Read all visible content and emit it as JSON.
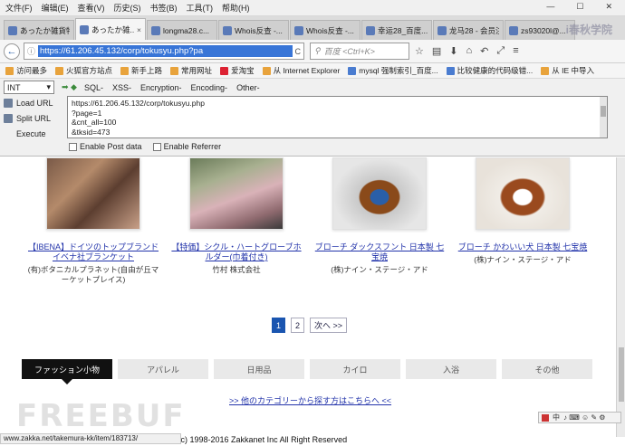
{
  "menu": [
    "文件(F)",
    "编辑(E)",
    "查看(V)",
    "历史(S)",
    "书签(B)",
    "工具(T)",
    "帮助(H)"
  ],
  "window_controls": [
    "—",
    "☐",
    "✕"
  ],
  "tabs": [
    {
      "title": "あったか雑貨特...",
      "active": false
    },
    {
      "title": "あったか雑...",
      "active": true
    },
    {
      "title": "longma28.c...",
      "active": false
    },
    {
      "title": "Whois反查 -...",
      "active": false
    },
    {
      "title": "Whois反查 -...",
      "active": false
    },
    {
      "title": "幸运28_百度...",
      "active": false
    },
    {
      "title": "龙马28 - 会员注册...",
      "active": false
    },
    {
      "title": "zs93020l@...",
      "active": false
    }
  ],
  "tab_close": "×",
  "nav": {
    "back": "←",
    "url": "https://61.206.45.132/corp/tokusyu.php?pa",
    "reload": "C",
    "search_placeholder": "百度 <Ctrl+K>",
    "icons": [
      "☆",
      "▤",
      "⬇",
      "⌂",
      "↶",
      "⤢",
      "≡"
    ]
  },
  "bookmarks": [
    "访问最多",
    "火狐官方站点",
    "新手上路",
    "常用网址",
    "爱淘宝",
    "从 Internet Explorer",
    "mysql 强制索引_百度...",
    "比较健康的代码级错...",
    "从 IE 中导入"
  ],
  "hackbar": {
    "select": "INT",
    "menus": [
      "SQL-",
      "XSS-",
      "Encryption-",
      "Encoding-",
      "Other-"
    ],
    "buttons": [
      "Load URL",
      "Split URL",
      "Execute"
    ],
    "textarea": "https://61.206.45.132/corp/tokusyu.php\n?page=1\n&cnt_all=100\n&tksid=473",
    "check_post": "Enable Post data",
    "check_referrer": "Enable Referrer"
  },
  "products": [
    {
      "name": "【IBENA】ドイツのトップブランド イベナ社ブランケット",
      "shop": "(有)ボタニカルプラネット(自由が丘マーケットプレイス)"
    },
    {
      "name": "【特価】シクル・ハートグローブホルダー(巾着付き)",
      "shop": "竹村 株式会社"
    },
    {
      "name": "ブローチ ダックスフント 日本製 七宝焼",
      "shop": "(株)ナイン・ステージ・アド"
    },
    {
      "name": "ブローチ かわいい犬 日本製 七宝焼",
      "shop": "(株)ナイン・ステージ・アド"
    }
  ],
  "pager": {
    "pages": [
      "1",
      "2"
    ],
    "current": "1",
    "next": "次へ >>"
  },
  "categories": [
    "ファッション小物",
    "アパレル",
    "日用品",
    "カイロ",
    "入浴",
    "その他"
  ],
  "active_category": "ファッション小物",
  "more_categories": ">> 他のカテゴリーから探す方はこちらへ <<",
  "ime": "中",
  "status_url": "www.zakka.net/takemura-kk/item/183713/",
  "copyright": "yright (c) 1998-2016 Zakkanet Inc All Right Reserved",
  "watermark": "FREEBUF",
  "corner_logo": "i春秋学院"
}
